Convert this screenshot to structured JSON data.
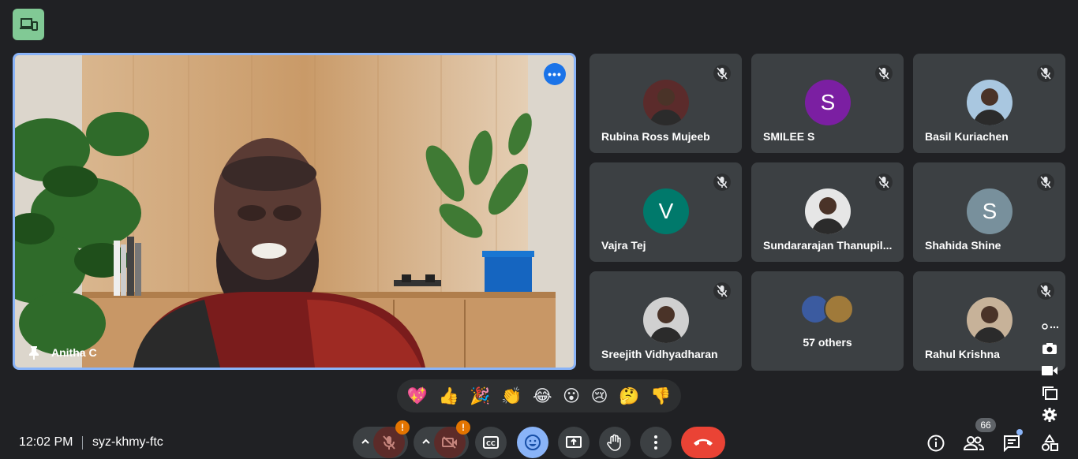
{
  "companion": {
    "icon": "devices-icon"
  },
  "main": {
    "name": "Anitha C",
    "pin_icon": "pin-icon",
    "more_label": "•••"
  },
  "participants": [
    {
      "name": "Rubina Ross Mujeeb",
      "initial": "",
      "avatar_color": "#5b2b2b",
      "photo": true
    },
    {
      "name": "SMILEE S",
      "initial": "S",
      "avatar_color": "#7b1fa2",
      "photo": false
    },
    {
      "name": "Basil Kuriachen",
      "initial": "",
      "avatar_color": "#a9c7e0",
      "photo": true
    },
    {
      "name": "Vajra Tej",
      "initial": "V",
      "avatar_color": "#00796b",
      "photo": false
    },
    {
      "name": "Sundararajan Thanupil...",
      "initial": "",
      "avatar_color": "#e6e6e6",
      "photo": true
    },
    {
      "name": "Shahida Shine",
      "initial": "S",
      "avatar_color": "#78909c",
      "photo": false
    },
    {
      "name": "Sreejith Vidhyadharan",
      "initial": "",
      "avatar_color": "#d0d0d0",
      "photo": true
    },
    {
      "name": "57 others",
      "initial": "",
      "avatar_color": "",
      "photo": false
    },
    {
      "name": "Rahul Krishna",
      "initial": "",
      "avatar_color": "#c7b299",
      "photo": true
    }
  ],
  "reactions": [
    "💖",
    "👍",
    "🎉",
    "👏",
    "😂",
    "😮",
    "😢",
    "🤔",
    "👎"
  ],
  "bottom": {
    "time": "12:02 PM",
    "meeting_code": "syz-khmy-ftc",
    "warn_mark": "!",
    "people_count": "66"
  },
  "colors": {
    "background": "#202124",
    "tile": "#3c4043",
    "accent": "#8ab4f8",
    "end_call": "#ea4335",
    "warning": "#e37400"
  }
}
